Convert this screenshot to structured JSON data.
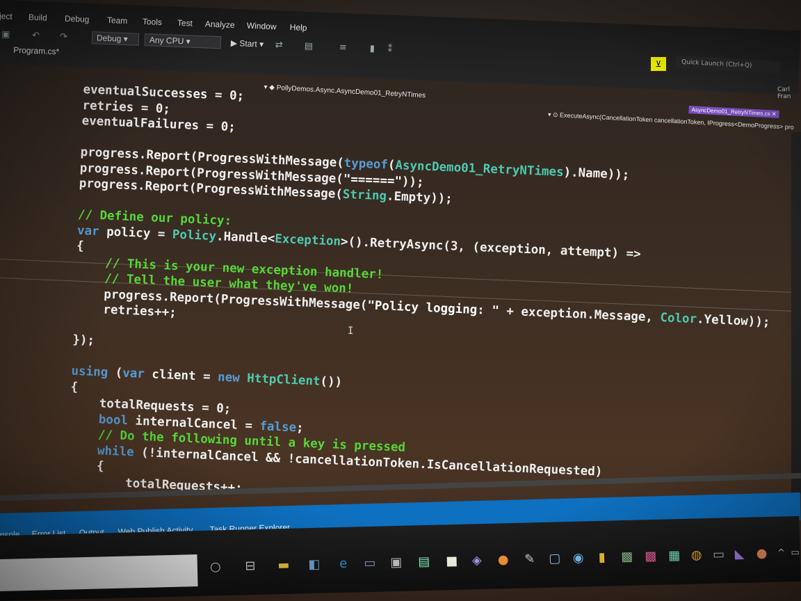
{
  "menu": {
    "items": [
      "ject",
      "Build",
      "Debug",
      "Team",
      "Tools",
      "Test",
      "Analyze",
      "Window",
      "Help"
    ]
  },
  "toolbar": {
    "config": "Debug",
    "platform": "Any CPU",
    "start_label": "Start"
  },
  "document_tab": "Program.cs*",
  "quick_launch_placeholder": "Quick Launch (Ctrl+Q)",
  "user": "Carl Fran",
  "navbar": {
    "left": "PollyDemos.Async.AsyncDemo01_RetryNTimes",
    "right": "ExecuteAsync(CancellationToken cancellationToken, IProgress<DemoProgress> pro",
    "badge": "AsyncDemo01_RetryNTimes.cs"
  },
  "code": {
    "l1": "eventualSuccesses = 0;",
    "l2": "retries = 0;",
    "l3": "eventualFailures = 0;",
    "l5a": "progress.Report(ProgressWithMessage(",
    "l5b": "typeof",
    "l5c": "(",
    "l5d": "AsyncDemo01_RetryNTimes",
    "l5e": ").Name));",
    "l6a": "progress.Report(ProgressWithMessage(",
    "l6b": "\"======\"",
    "l6c": "));",
    "l7a": "progress.Report(ProgressWithMessage(",
    "l7b": "String",
    "l7c": ".Empty));",
    "l9": "// Define our policy:",
    "l10a": "var",
    "l10b": " policy = ",
    "l10c": "Policy",
    "l10d": ".Handle<",
    "l10e": "Exception",
    "l10f": ">().RetryAsync(3, (exception, attempt) =>",
    "l11": "{",
    "l12": "    // This is your new exception handler!",
    "l13": "    // Tell the user what they've won!",
    "l14a": "    progress.Report(ProgressWithMessage(",
    "l14b": "\"Policy logging: \"",
    "l14c": " + exception.Message, ",
    "l14d": "Color",
    "l14e": ".Yellow));",
    "l15": "    retries++;",
    "l17": "});",
    "l19a": "using",
    "l19b": " (",
    "l19c": "var",
    "l19d": " client = ",
    "l19e": "new",
    "l19f": " ",
    "l19g": "HttpClient",
    "l19h": "())",
    "l20": "{",
    "l21": "    totalRequests = 0;",
    "l22a": "    ",
    "l22b": "bool",
    "l22c": " internalCancel = ",
    "l22d": "false",
    "l22e": ";",
    "l23": "    // Do the following until a key is pressed",
    "l24a": "    ",
    "l24b": "while",
    "l24c": " (!internalCancel && !cancellationToken.IsCancellationRequested)",
    "l25": "    {",
    "l26": "        totalRequests++;"
  },
  "panel_tabs": [
    "nsole",
    "Error List",
    "Output",
    "Web Publish Activity",
    "Task Runner Explorer"
  ],
  "colors": {
    "keyword": "#569cd6",
    "type": "#4ec9b0",
    "comment": "#57d63a",
    "panel": "#0e70c0",
    "filter": "#e5e500"
  }
}
